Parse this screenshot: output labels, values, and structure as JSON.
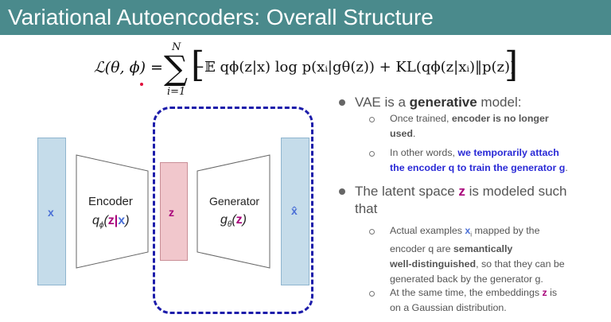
{
  "title": "Variational Autoencoders: Overall Structure",
  "formula": {
    "lhs": "ℒ(θ, ϕ) =",
    "sum_symbol": "∑",
    "sum_upper": "N",
    "sum_lower": "i=1",
    "bracket_open": "[",
    "bracket_close": "]",
    "rhs": "−𝔼 qϕ(z|x) log p(xᵢ|gθ(z)) + KL(qϕ(z|xᵢ)‖p(z))"
  },
  "diagram": {
    "x_label": "x",
    "z_label": "z",
    "xhat_label": "x̂",
    "encoder_title": "Encoder",
    "encoder_q": "q",
    "encoder_sub": "ϕ",
    "encoder_open": "(",
    "encoder_z": "z",
    "encoder_bar": "|",
    "encoder_x": "x",
    "encoder_close": ")",
    "generator_title": "Generator",
    "generator_g": "g",
    "generator_sub": "θ",
    "generator_open": "(",
    "generator_z": "z",
    "generator_close": ")"
  },
  "bullets": {
    "b1_pre": "VAE is a ",
    "b1_bold": "generative",
    "b1_post": " model:",
    "b1_sub1_pre": "Once trained, ",
    "b1_sub1_bold": "encoder is no longer",
    "b1_sub1_bold2": "used",
    "b1_sub1_post": ".",
    "b1_sub2_pre": "In other words, ",
    "b1_sub2_blue1": "we temporarily attach",
    "b1_sub2_blue2": "the encoder q to train the generator g",
    "b1_sub2_post": ".",
    "b2_pre": "The latent space ",
    "b2_z": "z",
    "b2_post": " is modeled such",
    "b2_line2": "that",
    "b2_sub1_l1_pre": "Actual examples ",
    "b2_sub1_x": "x",
    "b2_sub1_i": "i",
    "b2_sub1_l1_post": " mapped by the",
    "b2_sub1_l2_pre": "encoder q are ",
    "b2_sub1_l2_bold": "semantically",
    "b2_sub1_l3_bold": "well-distinguished",
    "b2_sub1_l3_post": ", so that they can be",
    "b2_sub1_l4": "generated back by the generator g.",
    "b2_sub2_l1_pre": "At the same time, the embeddings ",
    "b2_sub2_z": "z",
    "b2_sub2_l1_post": " is",
    "b2_sub2_l2": "on a Gaussian distribution."
  },
  "colors": {
    "title_bar": "#4a8a8c",
    "dashed_box": "#1c1caa",
    "z_block": "#f1c7cc",
    "x_block": "#c5dcea",
    "emphasis_blue": "#2a2ad6",
    "emphasis_purple": "#a8007a"
  }
}
